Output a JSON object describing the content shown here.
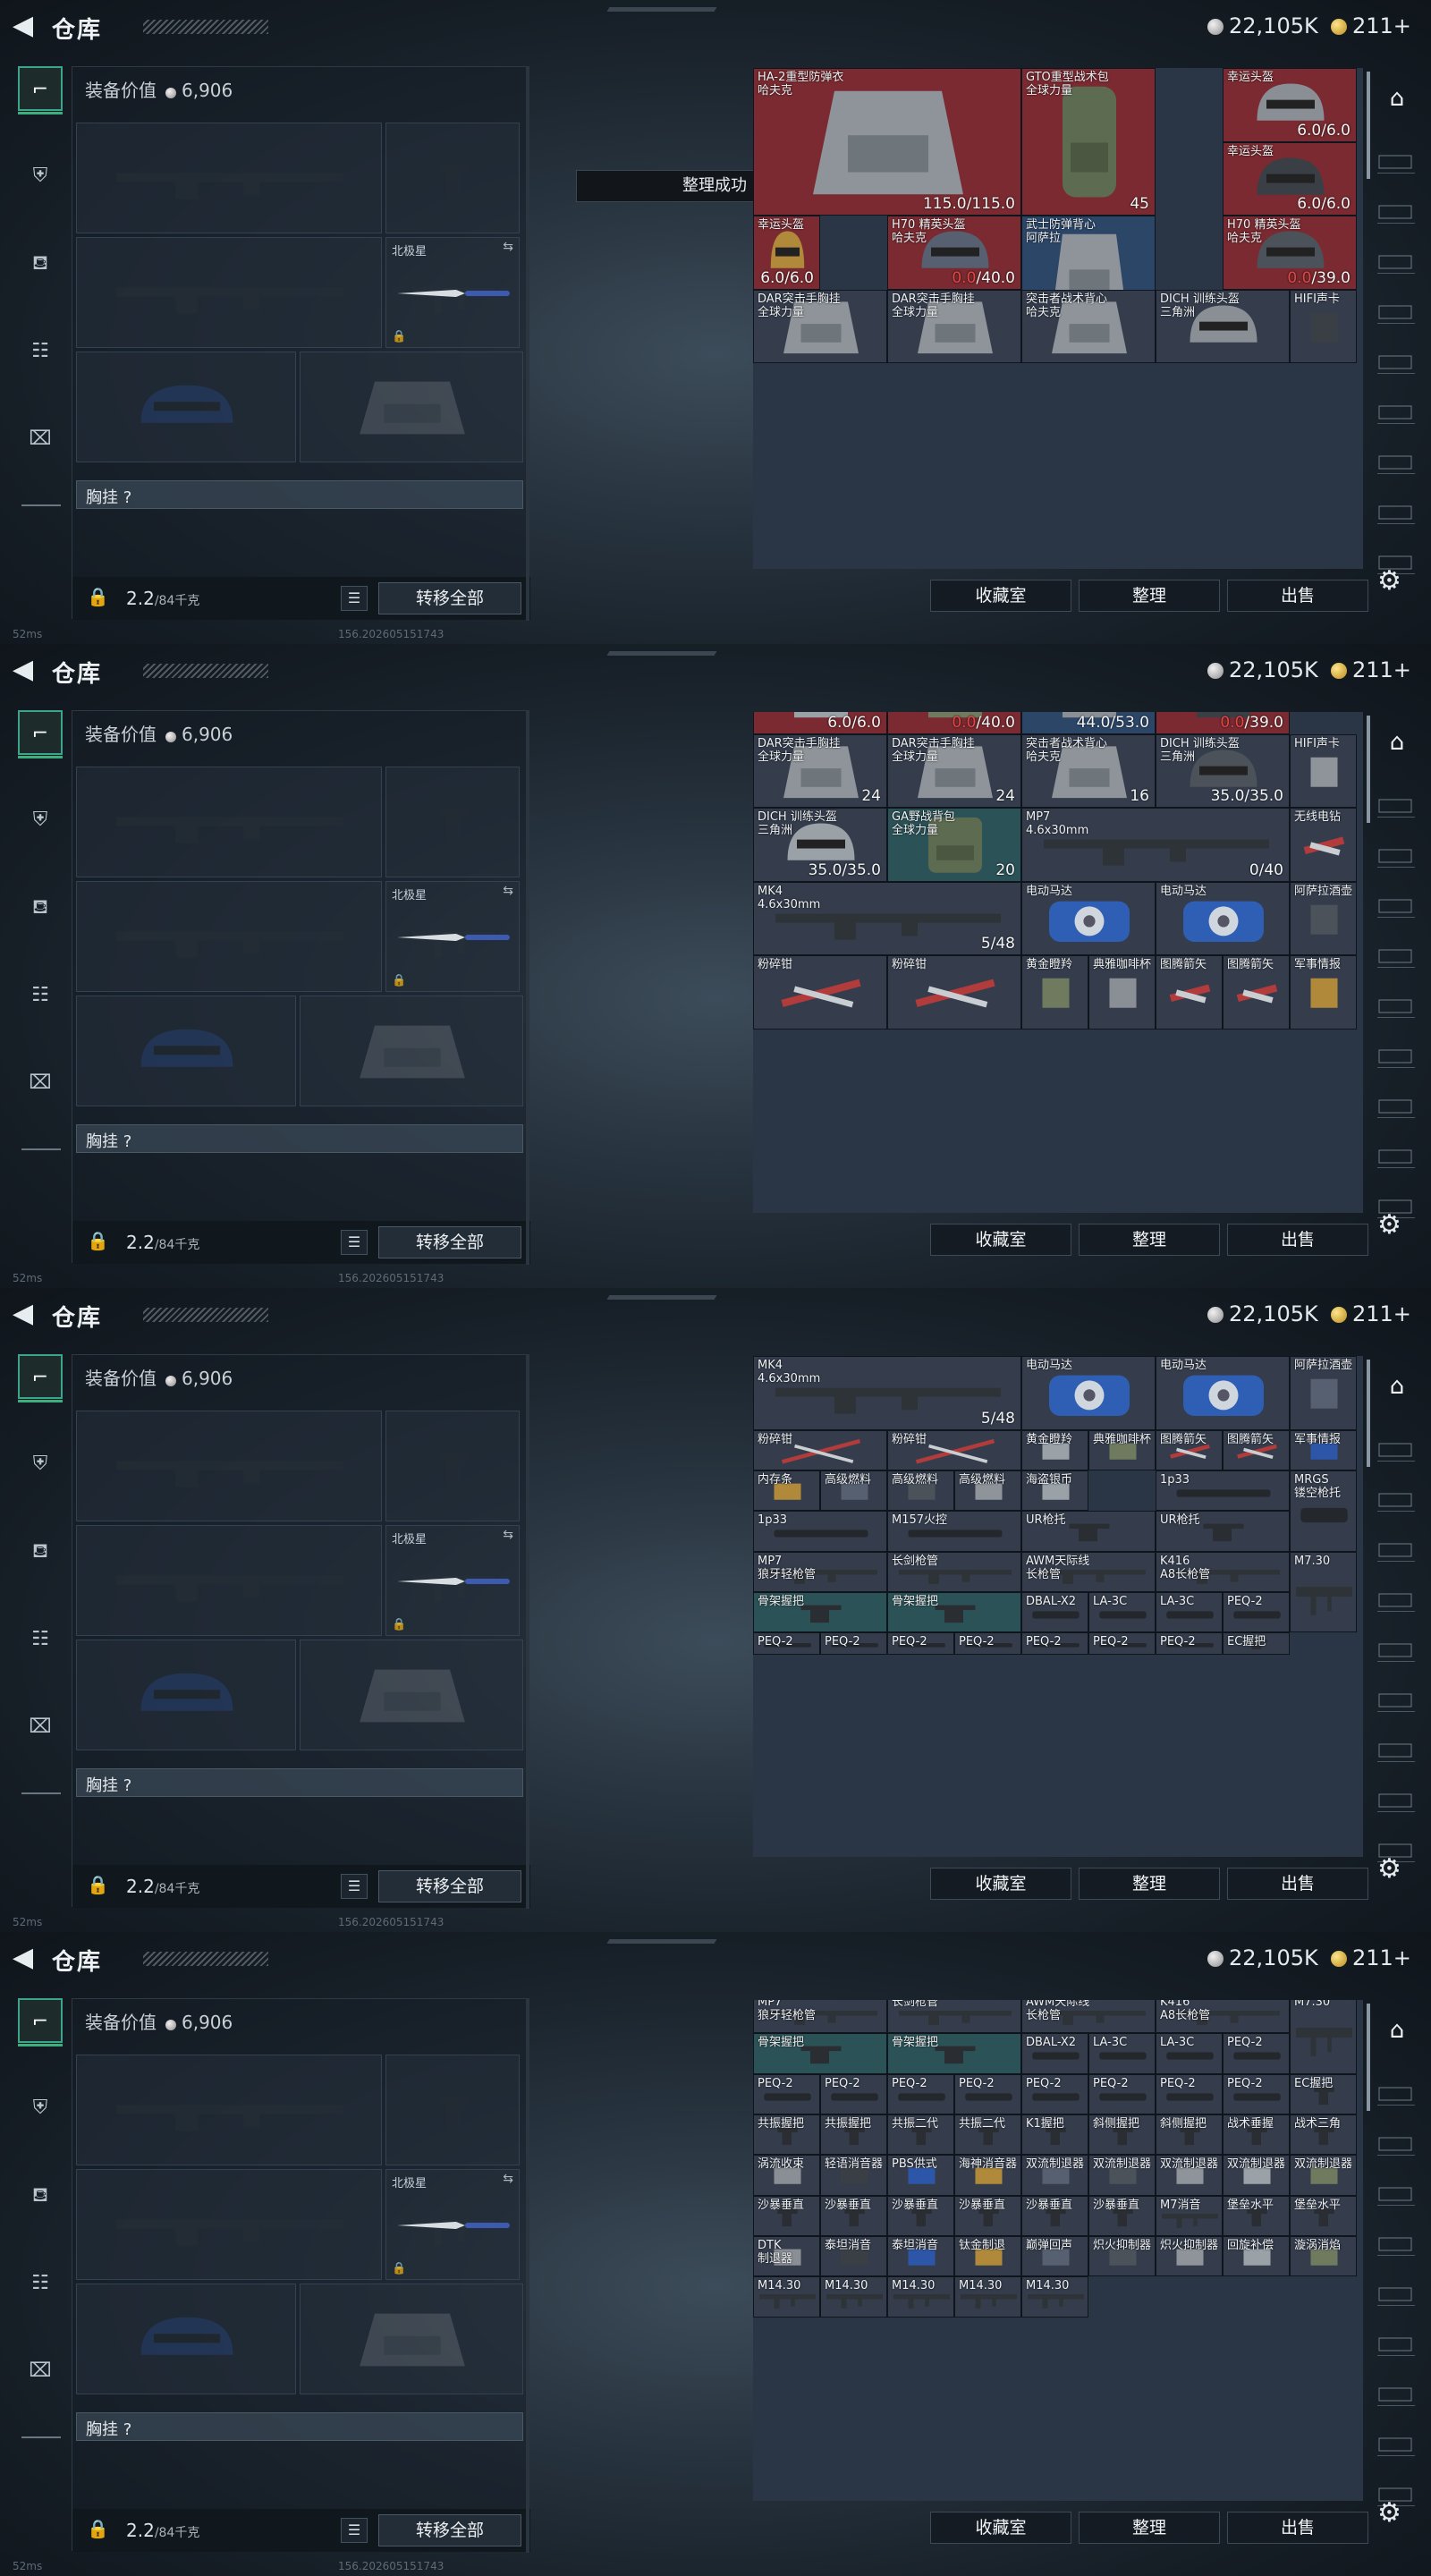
{
  "header": {
    "back_icon": "chevron-left-icon",
    "title": "仓库",
    "silver": "22,105K",
    "gold": "211+"
  },
  "left_nav": [
    "weapon-icon",
    "armor-icon",
    "backpack-icon",
    "clipboard-icon",
    "toolbox-icon"
  ],
  "equip": {
    "value_label": "装备价值",
    "value": "6,906",
    "melee_label": "北极星",
    "chest_rig_label": "胸挂 ?",
    "weight": "2.2",
    "weight_cap": "/84千克",
    "move_all": "转移全部"
  },
  "toast": "整理成功",
  "footer": {
    "ping": "52ms",
    "version": "156.202605151743"
  },
  "actions": {
    "collect": "收藏室",
    "sort": "整理",
    "sell": "出售"
  },
  "colors": {
    "red_bg": "#7a2a30",
    "blue_bg": "#2c4668",
    "teal_bg": "#2b5257",
    "gray_bg": "#353d4d"
  },
  "screens": [
    {
      "items": [
        {
          "n": "HA-2重型防弹衣\n哈夫克",
          "d": "115.0/115.0"
        },
        {
          "n": "GTO重型战术包\n全球力量",
          "d": "45"
        },
        {
          "n": "幸运头盔",
          "d": "6.0/6.0"
        },
        {
          "n": "幸运头盔",
          "d": "6.0/6.0"
        },
        {
          "n": "武士防弹背心\n阿萨拉",
          "d": "44.0/53.0"
        },
        {
          "n": "幸运头盔",
          "d": "6.0/6.0"
        },
        {
          "n": "H70 精英头盔\n哈夫克",
          "dr": "0.0",
          "dt": "/40.0"
        },
        {
          "n": "H70 精英头盔\n哈夫克",
          "dr": "0.0",
          "dt": "/39.0"
        },
        {
          "n": "DAR突击手胸挂\n全球力量"
        },
        {
          "n": "DAR突击手胸挂\n全球力量"
        },
        {
          "n": "突击者战术背心\n哈夫克"
        },
        {
          "n": "DICH 训练头盔\n三角洲"
        },
        {
          "n": "HIFI声卡"
        }
      ]
    },
    {
      "items": [
        {
          "n": "",
          "d": "6.0/6.0"
        },
        {
          "n": "",
          "dr": "0.0",
          "dt": "/40.0"
        },
        {
          "n": "",
          "d": "44.0/53.0"
        },
        {
          "n": "",
          "dr": "0.0",
          "dt": "/39.0"
        },
        {
          "n": "DAR突击手胸挂\n全球力量",
          "d": "24"
        },
        {
          "n": "DAR突击手胸挂\n全球力量",
          "d": "24"
        },
        {
          "n": "突击者战术背心\n哈夫克",
          "d": "16"
        },
        {
          "n": "DICH 训练头盔\n三角洲",
          "d": "35.0/35.0"
        },
        {
          "n": "HIFI声卡"
        },
        {
          "n": "DICH 训练头盔\n三角洲",
          "d": "35.0/35.0"
        },
        {
          "n": "GA野战背包\n全球力量",
          "d": "20"
        },
        {
          "n": "MP7\n4.6x30mm",
          "d": "0/40"
        },
        {
          "n": "无线电钻"
        },
        {
          "n": "MK4\n4.6x30mm",
          "d": "5/48"
        },
        {
          "n": "电动马达"
        },
        {
          "n": "电动马达"
        },
        {
          "n": "阿萨拉酒壶"
        },
        {
          "n": "粉碎钳"
        },
        {
          "n": "粉碎钳"
        },
        {
          "n": "黄金瞪羚"
        },
        {
          "n": "典雅咖啡杯"
        },
        {
          "n": "图腾箭矢"
        },
        {
          "n": "图腾箭矢"
        },
        {
          "n": "军事情报"
        }
      ]
    },
    {
      "items": [
        {
          "n": "",
          "d": "35.0/35.0"
        },
        {
          "n": "",
          "d": "20"
        },
        {
          "n": "",
          "d": "0/40"
        },
        {
          "n": "MK4\n4.6x30mm",
          "d": "5/48"
        },
        {
          "n": "电动马达"
        },
        {
          "n": "电动马达"
        },
        {
          "n": "阿萨拉酒壶"
        },
        {
          "n": "粉碎钳"
        },
        {
          "n": "粉碎钳"
        },
        {
          "n": "黄金瞪羚"
        },
        {
          "n": "典雅咖啡杯"
        },
        {
          "n": "图腾箭矢"
        },
        {
          "n": "图腾箭矢"
        },
        {
          "n": "军事情报"
        },
        {
          "n": "内存条"
        },
        {
          "n": "高级燃料"
        },
        {
          "n": "高级燃料"
        },
        {
          "n": "高级燃料"
        },
        {
          "n": "海盗银币"
        },
        {
          "n": "1p33"
        },
        {
          "n": "MRGS\n镂空枪托"
        },
        {
          "n": "1p33"
        },
        {
          "n": "M157火控"
        },
        {
          "n": "UR枪托"
        },
        {
          "n": "UR枪托"
        },
        {
          "n": "MP7\n狼牙轻枪管"
        },
        {
          "n": "长剑枪管"
        },
        {
          "n": "AWM天际线\n长枪管"
        },
        {
          "n": "K416\nA8长枪管"
        },
        {
          "n": "M7.30"
        },
        {
          "n": "骨架握把"
        },
        {
          "n": "骨架握把"
        },
        {
          "n": "DBAL-X2"
        },
        {
          "n": "LA-3C"
        },
        {
          "n": "LA-3C"
        },
        {
          "n": "PEQ-2"
        },
        {
          "n": "PEQ-2"
        },
        {
          "n": "PEQ-2"
        },
        {
          "n": "PEQ-2"
        },
        {
          "n": "PEQ-2"
        },
        {
          "n": "PEQ-2"
        },
        {
          "n": "PEQ-2"
        },
        {
          "n": "PEQ-2"
        },
        {
          "n": "EC握把"
        }
      ]
    },
    {
      "items": [
        {
          "n": "MP7\n狼牙轻枪管"
        },
        {
          "n": "长剑枪管"
        },
        {
          "n": "AWM天际线\n长枪管"
        },
        {
          "n": "K416\nA8长枪管"
        },
        {
          "n": "M7.30"
        },
        {
          "n": "骨架握把"
        },
        {
          "n": "骨架握把"
        },
        {
          "n": "DBAL-X2"
        },
        {
          "n": "LA-3C"
        },
        {
          "n": "LA-3C"
        },
        {
          "n": "PEQ-2"
        },
        {
          "n": "PEQ-2"
        },
        {
          "n": "PEQ-2"
        },
        {
          "n": "PEQ-2"
        },
        {
          "n": "PEQ-2"
        },
        {
          "n": "PEQ-2"
        },
        {
          "n": "PEQ-2"
        },
        {
          "n": "PEQ-2"
        },
        {
          "n": "PEQ-2"
        },
        {
          "n": "EC握把"
        },
        {
          "n": "共振握把"
        },
        {
          "n": "共振握把"
        },
        {
          "n": "共振二代"
        },
        {
          "n": "共振二代"
        },
        {
          "n": "K1握把"
        },
        {
          "n": "斜侧握把"
        },
        {
          "n": "斜侧握把"
        },
        {
          "n": "战术垂握"
        },
        {
          "n": "战术三角"
        },
        {
          "n": "涡流收束"
        },
        {
          "n": "轻语消音器"
        },
        {
          "n": "PBS供式"
        },
        {
          "n": "海神消音器"
        },
        {
          "n": "双流制退器"
        },
        {
          "n": "双流制退器"
        },
        {
          "n": "双流制退器"
        },
        {
          "n": "双流制退器"
        },
        {
          "n": "双流制退器"
        },
        {
          "n": "沙暴垂直"
        },
        {
          "n": "沙暴垂直"
        },
        {
          "n": "沙暴垂直"
        },
        {
          "n": "沙暴垂直"
        },
        {
          "n": "沙暴垂直"
        },
        {
          "n": "沙暴垂直"
        },
        {
          "n": "M7消音"
        },
        {
          "n": "堡垒水平"
        },
        {
          "n": "堡垒水平"
        },
        {
          "n": "DTK\n制退器"
        },
        {
          "n": "泰坦消音"
        },
        {
          "n": "泰坦消音"
        },
        {
          "n": "钛金制退"
        },
        {
          "n": "巅弹回声"
        },
        {
          "n": "炽火抑制器"
        },
        {
          "n": "炽火抑制器"
        },
        {
          "n": "回旋补偿"
        },
        {
          "n": "漩涡消焰"
        },
        {
          "n": "M14.30"
        },
        {
          "n": "M14.30"
        },
        {
          "n": "M14.30"
        },
        {
          "n": "M14.30"
        },
        {
          "n": "M14.30"
        }
      ]
    }
  ]
}
